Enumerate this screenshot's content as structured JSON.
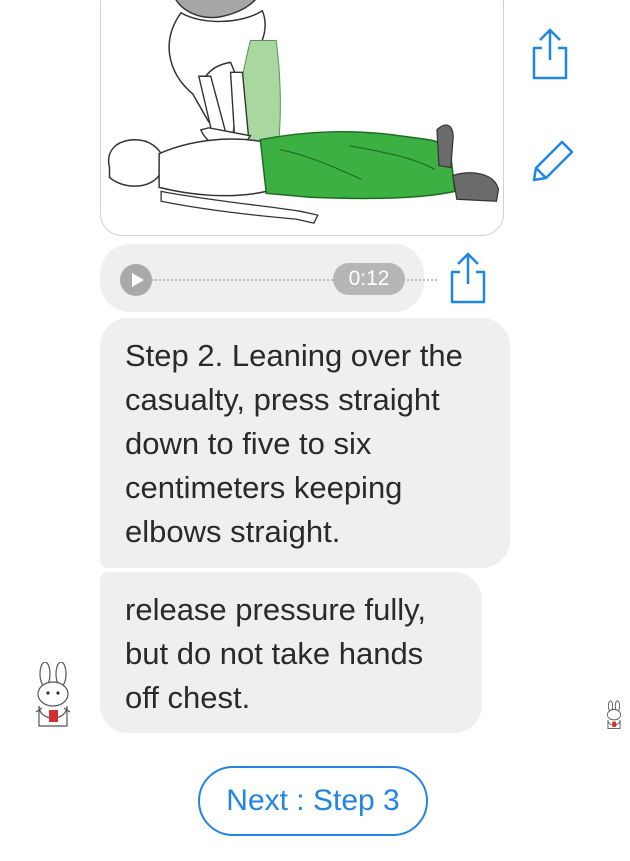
{
  "image_message": {
    "image_alt": "",
    "icons": [
      "share-icon",
      "edit-icon"
    ]
  },
  "audio_message": {
    "duration": "0:12"
  },
  "messages": [
    {
      "text": "Step 2. Leaning over the casualty, press straight down to five to six centimeters keeping elbows straight."
    },
    {
      "text": "release pressure fully, but do not take hands off chest."
    }
  ],
  "next_button": {
    "label": "Next : Step 3"
  },
  "colors": {
    "accent": "#1f86e6",
    "bubble": "#efefef",
    "pants_green": "#3cb043"
  }
}
